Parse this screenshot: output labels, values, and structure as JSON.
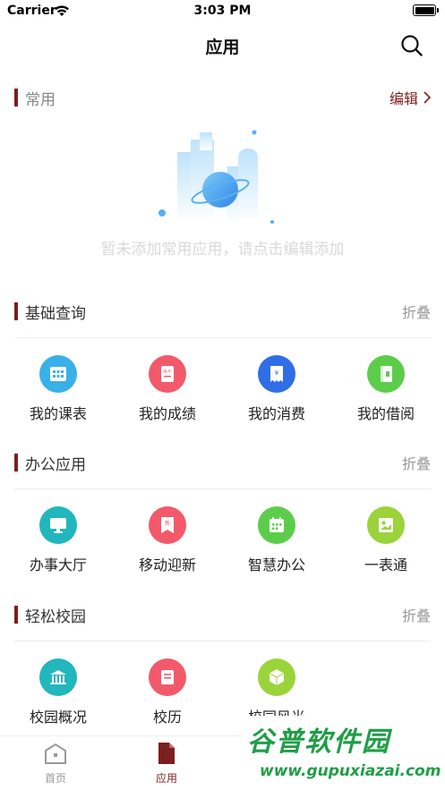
{
  "status_bar": {
    "carrier": "Carrier",
    "time": "3:03 PM",
    "battery_level": 1.0
  },
  "nav": {
    "title": "应用",
    "search_icon": "search-icon"
  },
  "common": {
    "title": "常用",
    "edit_label": "编辑",
    "empty_text": "暂未添加常用应用，请点击编辑添加"
  },
  "sections": [
    {
      "title": "基础查询",
      "collapse_label": "折叠",
      "apps": [
        {
          "label": "我的课表",
          "icon": "timetable-icon",
          "color": "#3ab0e8"
        },
        {
          "label": "我的成绩",
          "icon": "grade-icon",
          "color": "#f25a6b"
        },
        {
          "label": "我的消费",
          "icon": "receipt-icon",
          "color": "#2f6ee6"
        },
        {
          "label": "我的借阅",
          "icon": "book-icon",
          "color": "#5ccd4a"
        }
      ]
    },
    {
      "title": "办公应用",
      "collapse_label": "折叠",
      "apps": [
        {
          "label": "办事大厅",
          "icon": "monitor-icon",
          "color": "#22b6bd"
        },
        {
          "label": "移动迎新",
          "icon": "new-badge-icon",
          "color": "#f25a6b"
        },
        {
          "label": "智慧办公",
          "icon": "calendar-icon",
          "color": "#5ccd4a"
        },
        {
          "label": "一表通",
          "icon": "form-icon",
          "color": "#9bd33a"
        }
      ]
    },
    {
      "title": "轻松校园",
      "collapse_label": "折叠",
      "apps": [
        {
          "label": "校园概况",
          "icon": "institution-icon",
          "color": "#22b6bd"
        },
        {
          "label": "校历",
          "icon": "calendar-book-icon",
          "color": "#f25a6b"
        },
        {
          "label": "校园风光",
          "icon": "cube-icon",
          "color": "#9bd33a"
        }
      ]
    }
  ],
  "tabs": [
    {
      "label": "首页",
      "icon": "home-icon",
      "active": false
    },
    {
      "label": "应用",
      "icon": "document-icon",
      "active": true
    }
  ],
  "watermark": {
    "title": "谷普软件园",
    "url": "www.gupuxiazai.com"
  },
  "colors": {
    "brand": "#7c1f1f",
    "divider": "#ececec",
    "empty_text": "#d9d9d9"
  }
}
